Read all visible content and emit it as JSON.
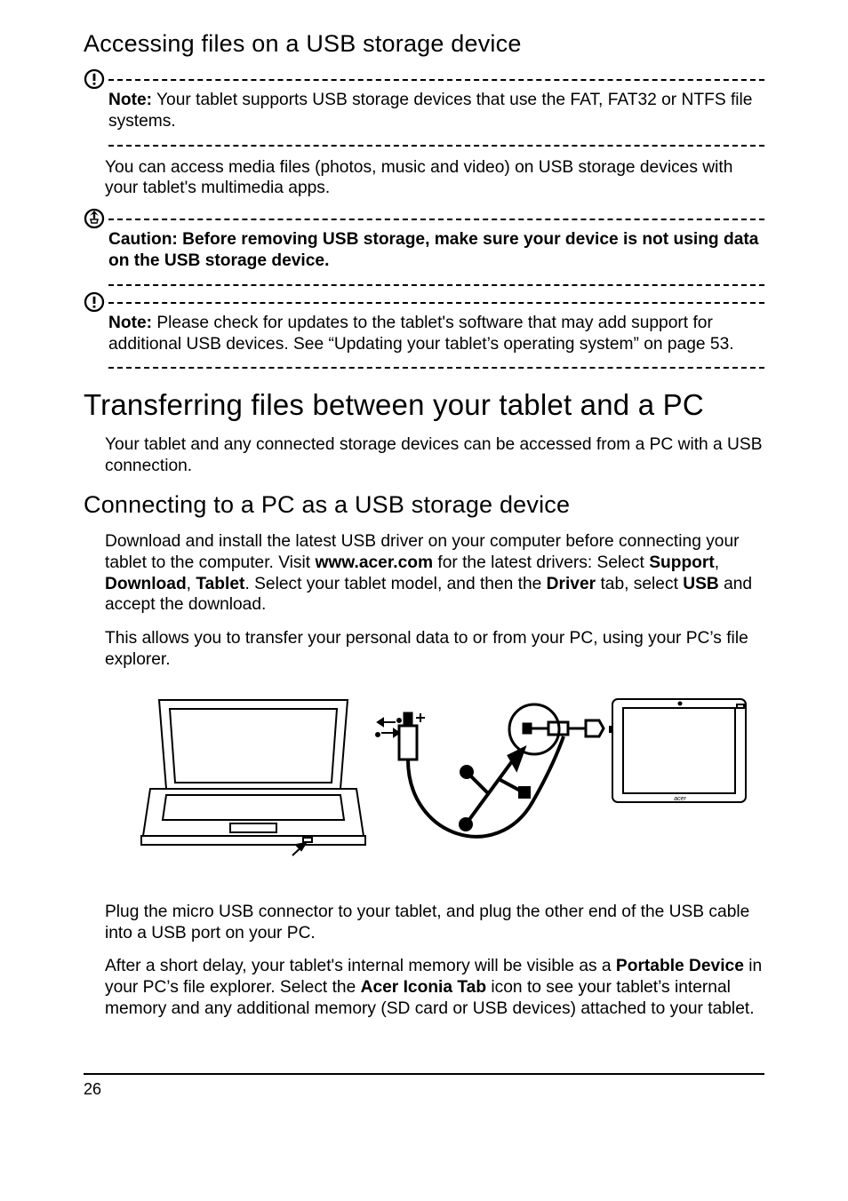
{
  "headings": {
    "h_access": "Accessing files on a USB storage device",
    "h_transfer": "Transferring files between your tablet and a PC",
    "h_connect": "Connecting to a PC as a USB storage device"
  },
  "note1": {
    "lead": "Note:",
    "text": " Your tablet supports USB storage devices that use the FAT, FAT32 or NTFS file systems."
  },
  "p_access": "You can access media files (photos, music and video) on USB storage devices with your tablet's multimedia apps.",
  "caution": {
    "lead": "Caution: Before removing USB storage, make sure your device is not using data on the USB storage device."
  },
  "note2": {
    "lead": "Note:",
    "text": " Please check for updates to the tablet's software that may add support for additional USB devices. See “Updating your tablet’s operating system” on page 53."
  },
  "p_transfer_intro": "Your tablet and any connected storage devices can be accessed from a PC with a USB connection.",
  "p_connect_1a": "Download and install the latest USB driver on your computer before connecting your tablet to the computer. Visit ",
  "p_connect_1b": "www.acer.com",
  "p_connect_1c": " for the latest drivers: Select ",
  "p_connect_1d": "Support",
  "p_connect_1e": ", ",
  "p_connect_1f": "Download",
  "p_connect_1g": ", ",
  "p_connect_1h": "Tablet",
  "p_connect_1i": ". Select your tablet model, and then the ",
  "p_connect_1j": "Driver",
  "p_connect_1k": " tab, select ",
  "p_connect_1l": "USB",
  "p_connect_1m": " and accept the download.",
  "p_connect_2": "This allows you to transfer your personal data to or from your PC, using your PC’s file explorer.",
  "p_plug": "Plug the micro USB connector to your tablet, and plug the other end of the USB cable into a USB port on your PC.",
  "p_after_a": "After a short delay, your tablet's internal memory will be visible as a ",
  "p_after_b": "Portable Device",
  "p_after_c": " in your PC’s file explorer. Select the ",
  "p_after_d": "Acer Iconia Tab",
  "p_after_e": " icon to see your tablet’s internal memory and any additional memory (SD card or USB devices) attached to your tablet.",
  "page_number": "26"
}
